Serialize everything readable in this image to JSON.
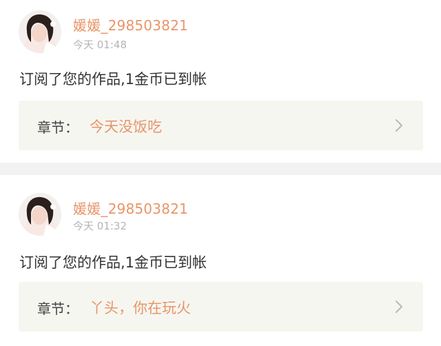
{
  "notifications": [
    {
      "username": "媛媛_298503821",
      "time": "今天 01:48",
      "message": "订阅了您的作品,1金币已到帐",
      "chapter_label": "章节：",
      "chapter_title": "今天没饭吃",
      "avatar_icon": "user-avatar",
      "chevron_icon": "chevron-right-icon"
    },
    {
      "username": "媛媛_298503821",
      "time": "今天 01:32",
      "message": "订阅了您的作品,1金币已到帐",
      "chapter_label": "章节：",
      "chapter_title": "丫头，你在玩火",
      "avatar_icon": "user-avatar",
      "chevron_icon": "chevron-right-icon"
    }
  ],
  "colors": {
    "accent": "#e8956a",
    "text": "#333333",
    "muted": "#b4b4b4",
    "chapter_bg": "#f6f6f0",
    "divider": "#f2f2f2"
  }
}
